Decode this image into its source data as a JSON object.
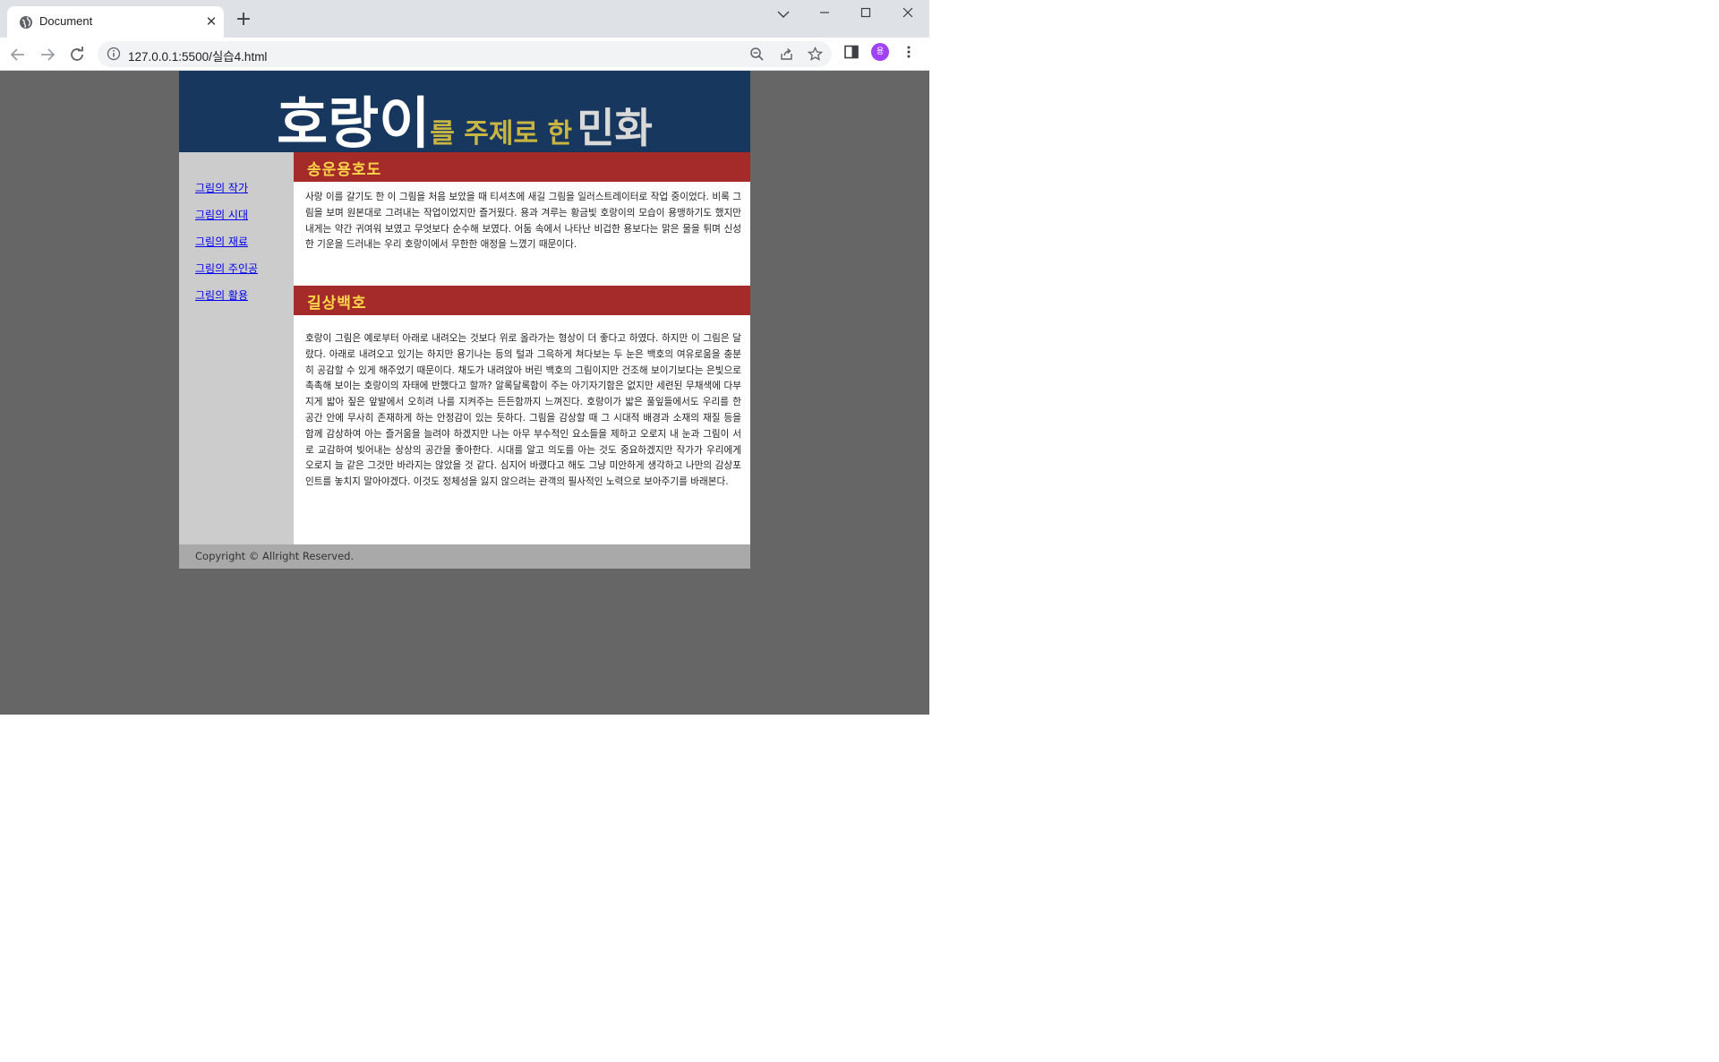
{
  "browser": {
    "tab_title": "Document",
    "url": "127.0.0.1:5500/실습4.html",
    "avatar_letter": "용",
    "icons": [
      "globe-icon",
      "close-icon",
      "plus-icon",
      "chevron-down-icon",
      "minimize-icon",
      "maximize-icon",
      "close-window-icon",
      "back-icon",
      "forward-icon",
      "reload-icon",
      "info-icon",
      "zoom-icon",
      "share-icon",
      "star-icon",
      "side-panel-icon",
      "menu-icon"
    ]
  },
  "header": {
    "big": "호랑이",
    "mid": "를 주제로 한",
    "end": "민화"
  },
  "nav": {
    "items": [
      "그림의 작가",
      "그림의 시대",
      "그림의 재료",
      "그림의 주인공",
      "그림의 활용"
    ]
  },
  "sections": [
    {
      "title": "송운용호도",
      "body": "사랑 이를 갈기도 한 이 그림을 처음 보았을 때 티셔츠에 새길 그림을 일러스트레이터로 작업 중이었다. 비록 그림을 보며 원본대로 그려내는 작업이었지만 즐거웠다. 용과 겨루는 황금빛 호랑이의 모습이 용맹하기도 했지만 내게는 약간 귀여워 보였고 무엇보다 순수해 보였다. 어둠 속에서 나타난 비겁한 용보다는 맑은 물을 튀며 신성한 기운을 드러내는 우리 호랑이에서 무한한 애정을 느꼈기 때문이다."
    },
    {
      "title": "길상백호",
      "body": "호랑이 그림은 예로부터 아래로 내려오는 것보다 위로 올라가는 형상이 더 좋다고 하였다. 하지만 이 그림은 달랐다. 아래로 내려오고 있기는 하지만 용기나는 등의 털과 그윽하게 쳐다보는 두 눈은 백호의 여유로움을 충분히 공감할 수 있게 해주었기 때문이다. 채도가 내려앉아 버린 백호의 그림이지만 건조해 보이기보다는 은빛으로 촉촉해 보이는 호랑이의 자태에 반했다고 할까? 알록달록함이 주는 아기자기함은 없지만 세련된 무채색에 다부지게 밟아 짚은 앞발에서 오히려 나를 지켜주는 든든함까지 느껴진다. 호랑이가 밟은 풀잎들에서도 우리를 한 공간 안에 무사히 존재하게 하는 안정감이 있는 듯하다. 그림을 감상할 때 그 시대적 배경과 소재의 재질 등을 함께 감상하여 아는 즐거움을 늘려야 하겠지만 나는 아무 부수적인 요소들을 제하고 오로지 내 눈과 그림이 서로 교감하여 빚어내는 상상의 공간을 좋아한다. 시대를 알고 의도를 아는 것도 중요하겠지만 작가가 우리에게 오로지 늘 같은 그것만 바라지는 않았을 것 같다. 심지어 바랬다고 해도 그냥 미안하게 생각하고 나만의 감상포인트를 놓치지 말아야겠다. 이것도 정체성을 잃지 않으려는 관객의 필사적인 노력으로 보아주기를 바래본다."
    }
  ],
  "footer": {
    "text": "Copyright © Allright Reserved."
  },
  "colors": {
    "header_bg": "#17375e",
    "section_head_bg": "#a52a2a",
    "section_head_text": "#ffd54a",
    "sidebar_bg": "#cccccc",
    "page_bg": "#666666",
    "footer_bg": "#a9a9a9"
  }
}
